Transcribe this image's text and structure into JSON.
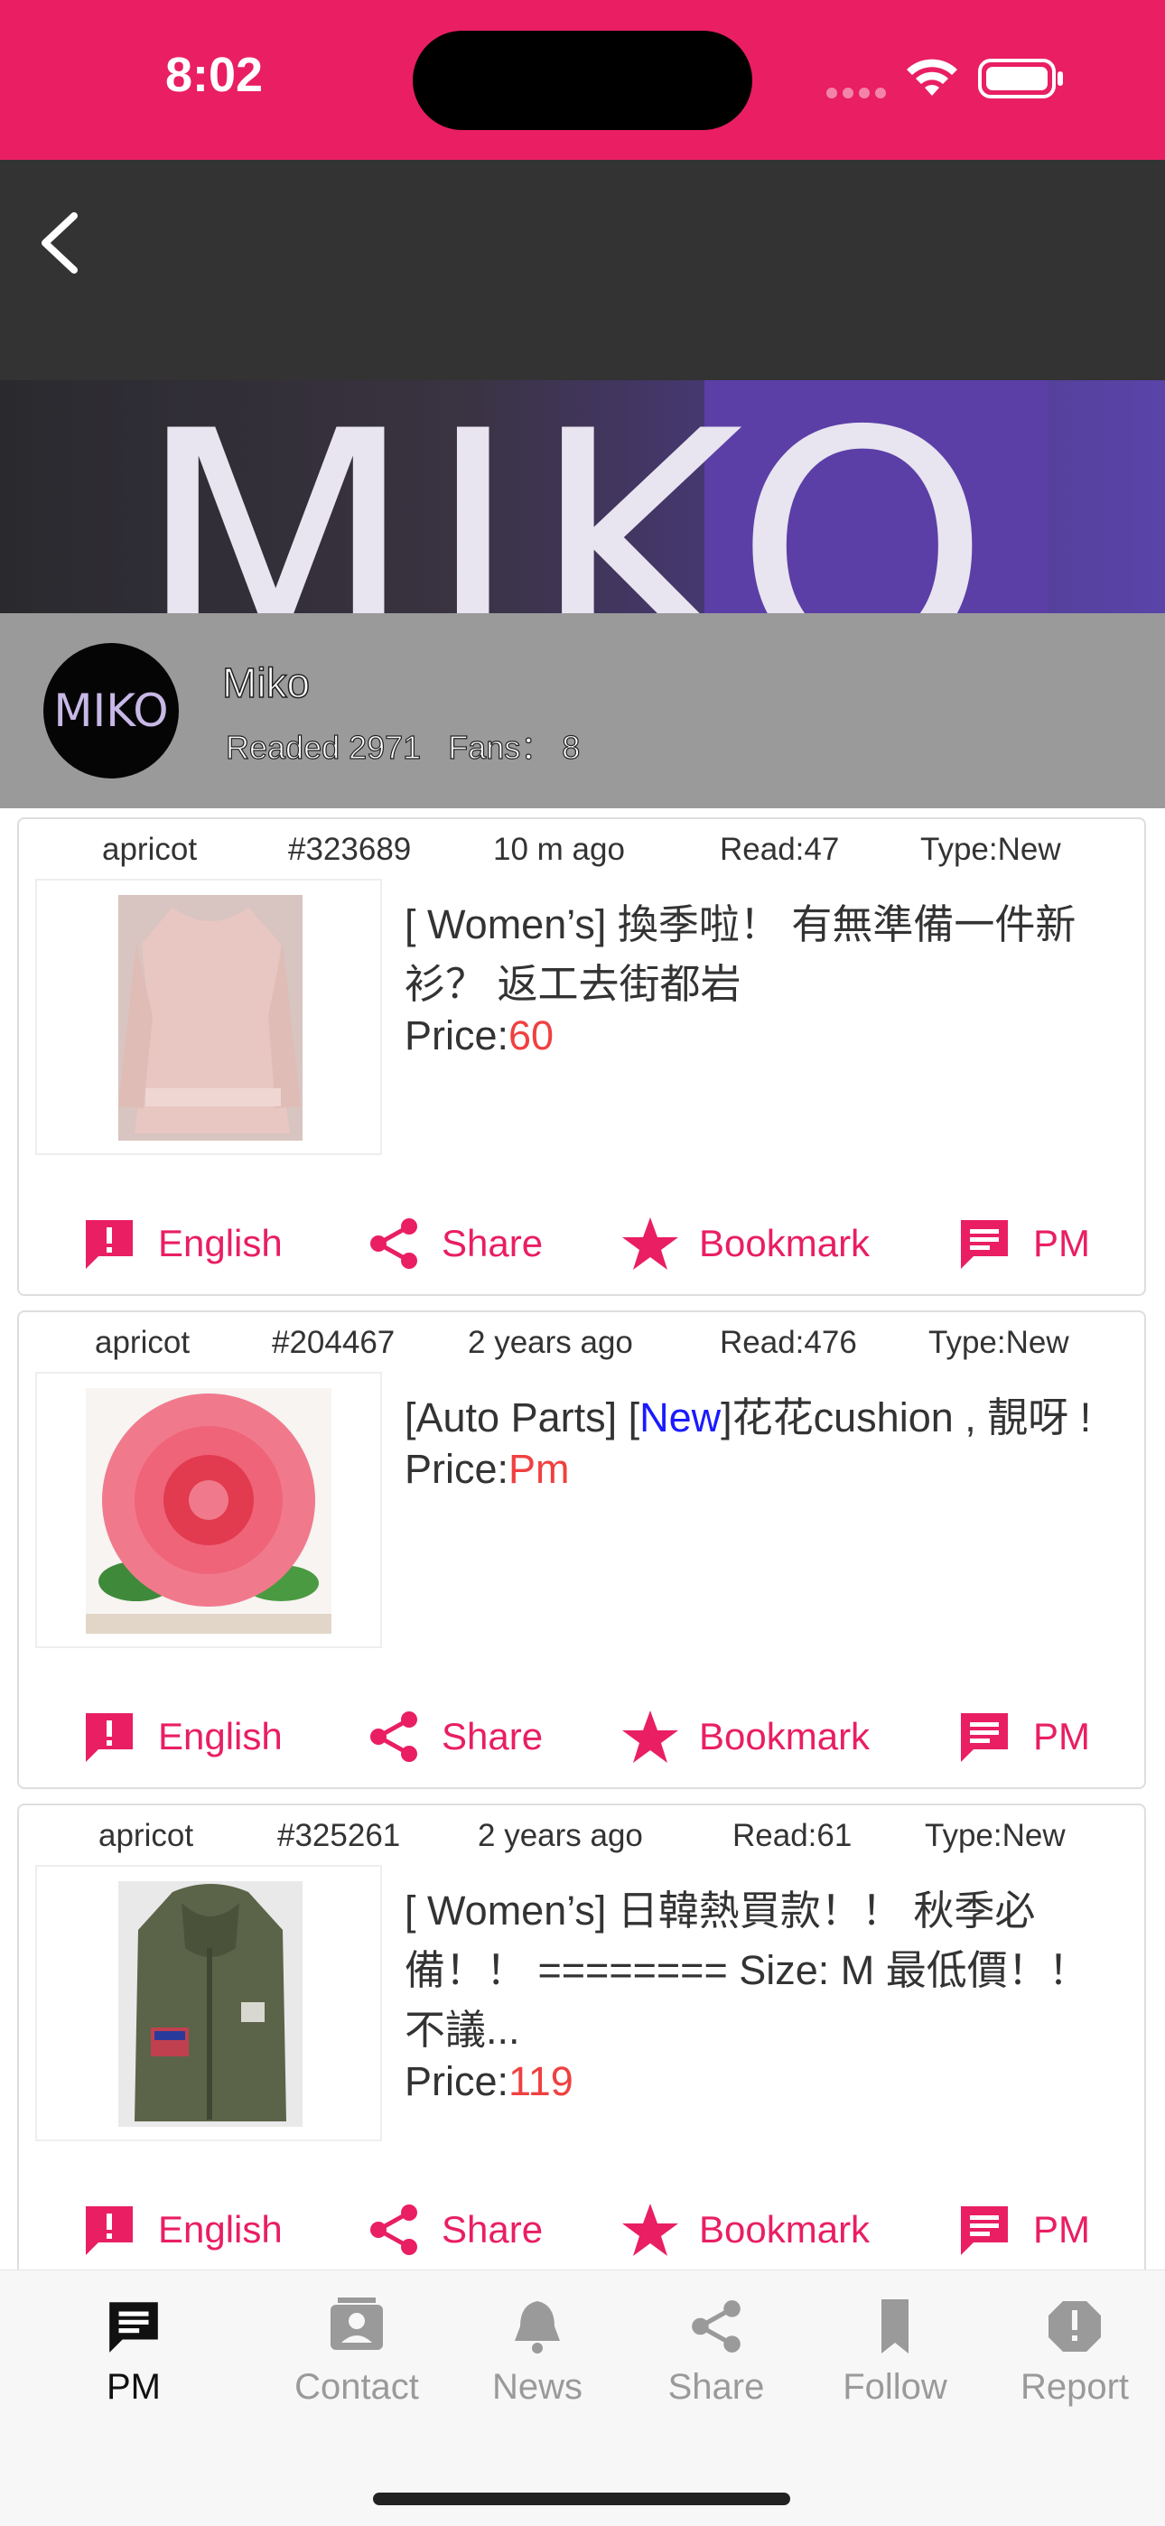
{
  "status_bar": {
    "time": "8:02"
  },
  "header": {
    "back_icon": "chevron-left-icon"
  },
  "banner": {
    "text": "MIKO"
  },
  "profile": {
    "avatar_text": "MIKO",
    "name": "Miko",
    "readed": "Readed 2971",
    "fans": "Fans： 8"
  },
  "posts": [
    {
      "user": "apricot",
      "id": "#323689",
      "time": "10 m  ago",
      "read": "Read:47",
      "type": "Type:New",
      "title": "[ Women’s] 換季啦！ 有無準備一件新衫？ 返工去街都岩",
      "price_label": "Price:",
      "price_value": "60"
    },
    {
      "user": "apricot",
      "id": "#204467",
      "time": "2 years  ago",
      "read": "Read:476",
      "type": "Type:New",
      "title_prefix": "[Auto Parts] [",
      "title_tag": "New",
      "title_suffix": "]花花cushion , 靚呀 !",
      "price_label": "Price:",
      "price_value": "Pm"
    },
    {
      "user": "apricot",
      "id": "#325261",
      "time": "2 years  ago",
      "read": "Read:61",
      "type": "Type:New",
      "title": "[ Women’s] 日韓熱買款！！ 秋季必備！！ ======== Size: M 最低價！！ 不議...",
      "price_label": "Price:",
      "price_value": "119"
    }
  ],
  "actions": {
    "english": "English",
    "share": "Share",
    "bookmark": "Bookmark",
    "pm": "PM"
  },
  "tabbar": {
    "items": [
      {
        "label": "PM",
        "icon": "message-icon"
      },
      {
        "label": "Contact",
        "icon": "contact-card-icon"
      },
      {
        "label": "News",
        "icon": "bell-icon"
      },
      {
        "label": "Share",
        "icon": "share-icon"
      },
      {
        "label": "Follow",
        "icon": "bookmark-icon"
      },
      {
        "label": "Report",
        "icon": "report-icon"
      }
    ]
  },
  "colors": {
    "accent": "#e91e63",
    "price": "#f04040",
    "new_tag": "#1a1aff",
    "header_bg": "#333333"
  }
}
